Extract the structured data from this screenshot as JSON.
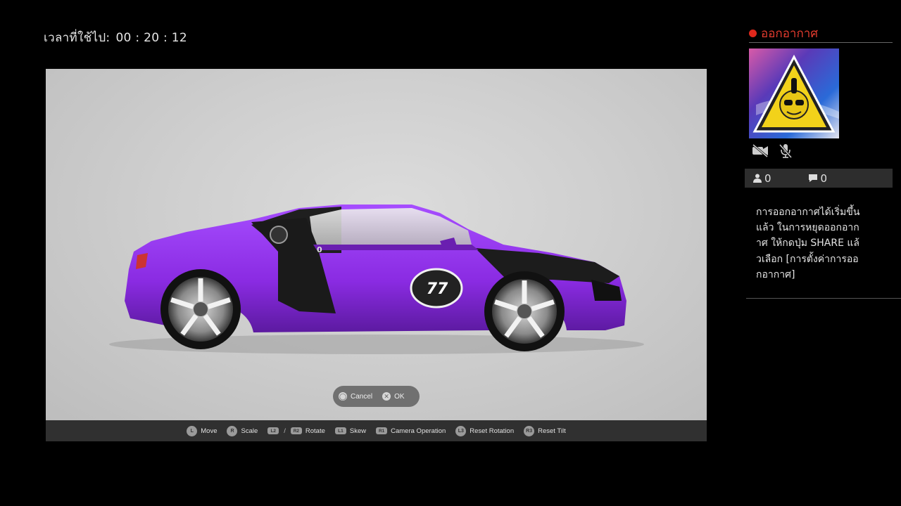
{
  "hud": {
    "elapsed_label": "เวลาที่ใช้ไป:",
    "elapsed_value": "00 : 20 : 12"
  },
  "car": {
    "number": "77",
    "small_number": "0",
    "body_color": "#8a2be2",
    "accent_color": "#1a1a1a"
  },
  "dialog": {
    "cancel_label": "Cancel",
    "ok_label": "OK"
  },
  "controls": {
    "move": {
      "button": "L",
      "label": "Move"
    },
    "scale": {
      "button": "R",
      "label": "Scale"
    },
    "rotate": {
      "button_a": "L2",
      "slash": "/",
      "button_b": "R2",
      "label": "Rotate"
    },
    "skew": {
      "button": "L1",
      "label": "Skew"
    },
    "camera": {
      "button": "R1",
      "label": "Camera Operation"
    },
    "reset_rotation": {
      "button": "L3",
      "label": "Reset Rotation"
    },
    "reset_tilt": {
      "button": "R3",
      "label": "Reset Tilt"
    }
  },
  "broadcast": {
    "status": "ออกอากาศ",
    "viewers": "0",
    "comments": "0",
    "message": "การออกอากาศได้เริ่มขึ้นแล้ว ในการหยุดออกอากาศ ให้กดปุ่ม SHARE แล้วเลือก [การตั้งค่าการออกอากาศ]",
    "status_color": "#e23b2e",
    "icons": [
      "camera-off-icon",
      "mic-off-icon",
      "person-icon",
      "comment-icon"
    ]
  }
}
